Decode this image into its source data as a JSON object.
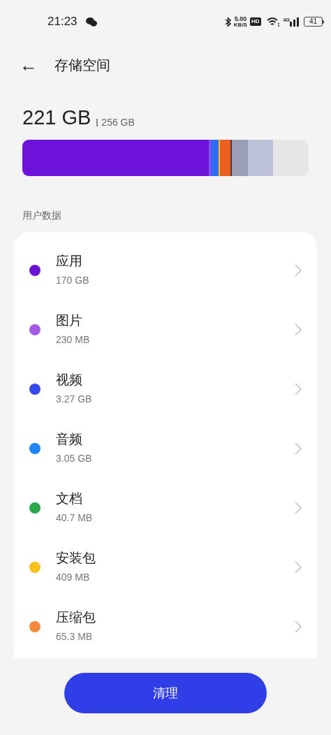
{
  "status_bar": {
    "time": "21:23",
    "net_speed": "5.00",
    "net_unit": "KB/S",
    "hd_badge": "HD",
    "network": "4G",
    "battery": "41"
  },
  "header": {
    "back": "←",
    "title": "存储空间"
  },
  "storage": {
    "used": "221 GB",
    "total": "256 GB",
    "segments": [
      {
        "color": "#6d12d9"
      },
      {
        "color": "#8a4df0"
      },
      {
        "color": "#2f6cf2"
      },
      {
        "color": "#f2c12e"
      },
      {
        "color": "#ec5f20"
      },
      {
        "color": "#5a3a33"
      },
      {
        "color": "#9a9fb5"
      },
      {
        "color": "#bcc1d8"
      }
    ]
  },
  "section_title": "用户数据",
  "items": [
    {
      "name": "应用",
      "size": "170 GB",
      "color": "#6a12d6"
    },
    {
      "name": "图片",
      "size": "230 MB",
      "color": "#a55ae6"
    },
    {
      "name": "视频",
      "size": "3.27 GB",
      "color": "#3548e8"
    },
    {
      "name": "音频",
      "size": "3.05 GB",
      "color": "#1f84f5"
    },
    {
      "name": "文档",
      "size": "40.7 MB",
      "color": "#2aa84a"
    },
    {
      "name": "安装包",
      "size": "409 MB",
      "color": "#f7c21d"
    },
    {
      "name": "压缩包",
      "size": "65.3 MB",
      "color": "#f68a3a"
    }
  ],
  "button": "清理"
}
